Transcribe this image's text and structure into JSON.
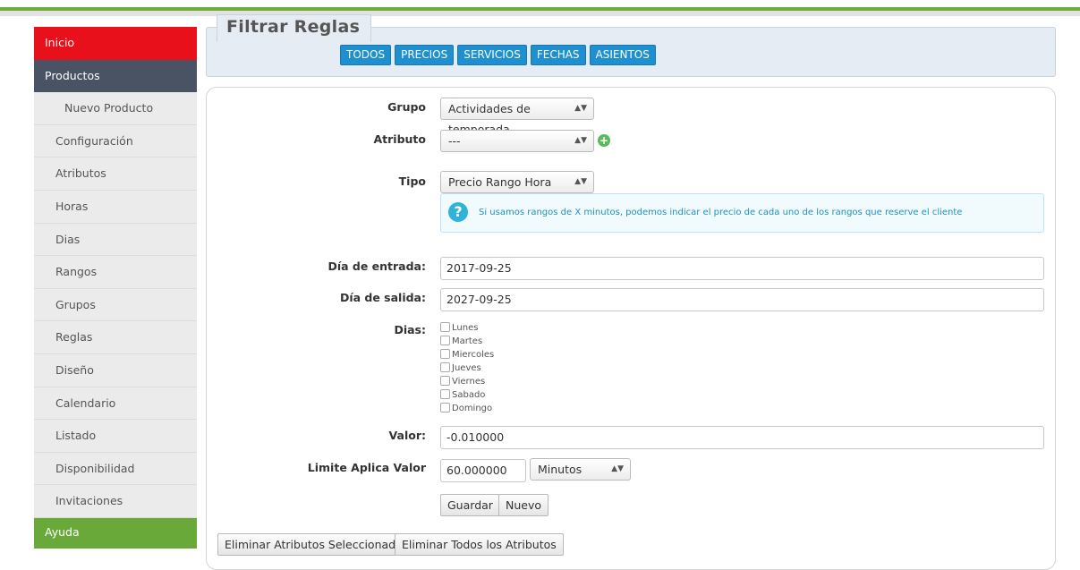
{
  "sidebar": {
    "items": [
      {
        "label": "Inicio"
      },
      {
        "label": "Productos"
      },
      {
        "label": "Nuevo Producto"
      },
      {
        "label": "Configuración"
      },
      {
        "label": "Atributos"
      },
      {
        "label": "Horas"
      },
      {
        "label": "Dias"
      },
      {
        "label": "Rangos"
      },
      {
        "label": "Grupos"
      },
      {
        "label": "Reglas"
      },
      {
        "label": "Diseño"
      },
      {
        "label": "Calendario"
      },
      {
        "label": "Listado"
      },
      {
        "label": "Disponibilidad"
      },
      {
        "label": "Invitaciones"
      },
      {
        "label": "Ayuda"
      }
    ],
    "colors": {
      "inicio": "#e8101a",
      "productos": "#4a5363",
      "ayuda": "#69a93a"
    }
  },
  "filter": {
    "title": "Filtrar Reglas",
    "buttons": [
      "TODOS",
      "PRECIOS",
      "SERVICIOS",
      "FECHAS",
      "ASIENTOS"
    ],
    "button_color": "#1e90d0"
  },
  "form": {
    "grupo": {
      "label": "Grupo",
      "value": "Actividades de temporada"
    },
    "atributo": {
      "label": "Atributo",
      "value": "---"
    },
    "tipo": {
      "label": "Tipo",
      "value": "Precio Rango Hora"
    },
    "info": "Si usamos rangos de X minutos, podemos indicar el precio de cada uno de los rangos que reserve el cliente",
    "dia_entrada": {
      "label": "Día de entrada:",
      "value": "2017-09-25"
    },
    "dia_salida": {
      "label": "Día de salida:",
      "value": "2027-09-25"
    },
    "dias": {
      "label": "Dias:",
      "options": [
        "Lunes",
        "Martes",
        "Miercoles",
        "Jueves",
        "Viernes",
        "Sabado",
        "Domingo"
      ]
    },
    "valor": {
      "label": "Valor:",
      "value": "-0.010000"
    },
    "limite": {
      "label": "Limite Aplica Valor",
      "value": "60.000000",
      "unit": "Minutos"
    },
    "guardar": "Guardar",
    "nuevo": "Nuevo",
    "eliminar_sel": "Eliminar Atributos Seleccionados",
    "eliminar_todos": "Eliminar Todos los Atributos"
  }
}
